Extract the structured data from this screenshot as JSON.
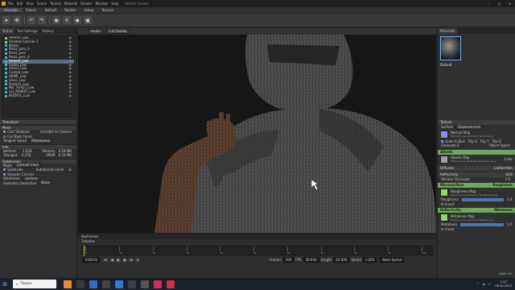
{
  "titlebar": {
    "menu": [
      "File",
      "Edit",
      "View",
      "Scene",
      "Toolset",
      "Material",
      "Render",
      "Window",
      "Help"
    ],
    "title": "Render Access",
    "window_buttons": [
      "–",
      "□",
      "✕"
    ]
  },
  "tabs": [
    "Animate",
    "Classic",
    "Default",
    "Render",
    "Setup",
    "Texture"
  ],
  "left_panel": {
    "tabs": [
      "Scene",
      "Tool Settings",
      "History"
    ],
    "scene_items": [
      {
        "label": "Helmet_Low",
        "selected": false
      },
      {
        "label": "Shadow Catcher 1",
        "selected": false
      },
      {
        "label": "Model",
        "selected": false
      },
      {
        "label": "Pieza_pers_3",
        "selected": false
      },
      {
        "label": "Pieza_pers",
        "selected": false
      },
      {
        "label": "Pieza_pers_4",
        "selected": false
      },
      {
        "label": "Helmet_Low",
        "selected": true
      },
      {
        "label": "Gorka_Low",
        "selected": false
      },
      {
        "label": "Armor_Low",
        "selected": false
      },
      {
        "label": "Cuerpo_Low",
        "selected": false
      },
      {
        "label": "ARMR_Low",
        "selected": false
      },
      {
        "label": "Glass_Low",
        "selected": false
      },
      {
        "label": "Protech_Low",
        "selected": false
      },
      {
        "label": "Nkr_Armor_Low",
        "selected": false
      },
      {
        "label": "Lot_ARMOR_Low",
        "selected": false
      },
      {
        "label": "BODY01_Low",
        "selected": false
      }
    ],
    "transform_header": "Transform",
    "mesh_header": "Mesh",
    "mesh_props": [
      {
        "label": "Cast Shadows",
        "value": "Invisible to Camera"
      },
      {
        "label": "Cull Back Faces",
        "value": ""
      }
    ],
    "tangent_label": "Tangent Space",
    "tangent_value": "Mikktspace",
    "info_header": "Info",
    "vertices_label": "Vertices",
    "vertices_value": "1.62B",
    "memory_label": "Memory",
    "memory_value": "0.18 MB",
    "triangles_label": "Triangles",
    "triangles_value": "4.27K",
    "vram_label": "VRAM",
    "vram_value": "0.18 MB",
    "subdivision_header": "Subdivision",
    "mode_label": "Mode",
    "mode_value": "Catmull-Clark",
    "subdiv_label": "Subdivide",
    "subdiv_level_label": "Subdivision Level",
    "subdiv_level_value": "3",
    "sharpen_label": "Sharpen Corners",
    "wireframe_label": "Wireframe",
    "wireframe_value": "Uniform",
    "geometry_label": "Geometry Reduction",
    "geometry_value": "None"
  },
  "viewport": {
    "camera": "render",
    "quality": "Full Quality"
  },
  "right_panel": {
    "header": "Materials",
    "material_name": "Default",
    "sections": {
      "texture": "Texture",
      "surface": "Surface",
      "surface_value": "Displacement",
      "normal_map": "Normal Map",
      "normal_file": "Helmet_Low_Lambert1_Normal.png",
      "scale_bias": "Scale & Bias",
      "flip_x": "Flip X",
      "flip_y": "Flip Y",
      "flip_z": "Flip Z",
      "generate_z": "Generate Z",
      "object_space": "Object Space",
      "albedo": "Albedo",
      "albedo_value": "Albedo",
      "albedo_map": "Albedo Map",
      "albedo_file": "Helmet_Low_lambert1_BaseColor.png",
      "color_label": "Color",
      "diffusion": "Diffusion",
      "diffusion_value": "Lambertian",
      "reflectivity": "Reflectivity",
      "reflectivity_value": "GGX",
      "horizon_label": "Horizon Occlusion",
      "horizon_value": "1.0",
      "microsurface": "Microsurface",
      "microsurface_value": "Roughness",
      "roughness_map": "Roughness Map",
      "roughness_file": "Helmet_Low_Lambert1_Roughness.png",
      "channel_label": "Channel",
      "channel_value": "R",
      "roughness_label": "Roughness",
      "roughness_value": "1.0",
      "invert_label": "Invert",
      "reflectivity2": "Reflectivity",
      "reflectivity2_value": "Metalness",
      "metalness_map": "Metalness Map",
      "metalness_file": "Helmet_Low_Lambert1_Metallic.png",
      "metalness_label": "Metalness",
      "metalness_value": "1.0",
      "invert2_label": "Invert"
    },
    "status": "VRAM: 6%"
  },
  "timeline": {
    "tabs": [
      "Keyframes"
    ],
    "label": "Timeline",
    "time_display": "0:00.01",
    "ticks": [
      "0",
      "1s",
      "2s",
      "3s",
      "4s",
      "5s",
      "6s",
      "7s",
      "8s",
      "9s",
      "10s"
    ],
    "frames_label": "Frames",
    "frames_value": "300",
    "fps_label": "FPS",
    "fps_value": "30.000",
    "length_label": "Length",
    "length_value": "10.000",
    "speed_label": "Speed",
    "speed_value": "1.000",
    "bake_label": "Bake Speed"
  },
  "taskbar": {
    "search_placeholder": "Поиск",
    "time": "1:27",
    "date": "08.05.2023"
  },
  "colors": {
    "accent": "#6fa85b",
    "selection": "#5a6c80",
    "albedo_swatch": "#a69aa0",
    "normal_swatch": "#8a8cff",
    "roughness_swatch": "#8fd46e",
    "metal_swatch": "#8fd46e"
  }
}
